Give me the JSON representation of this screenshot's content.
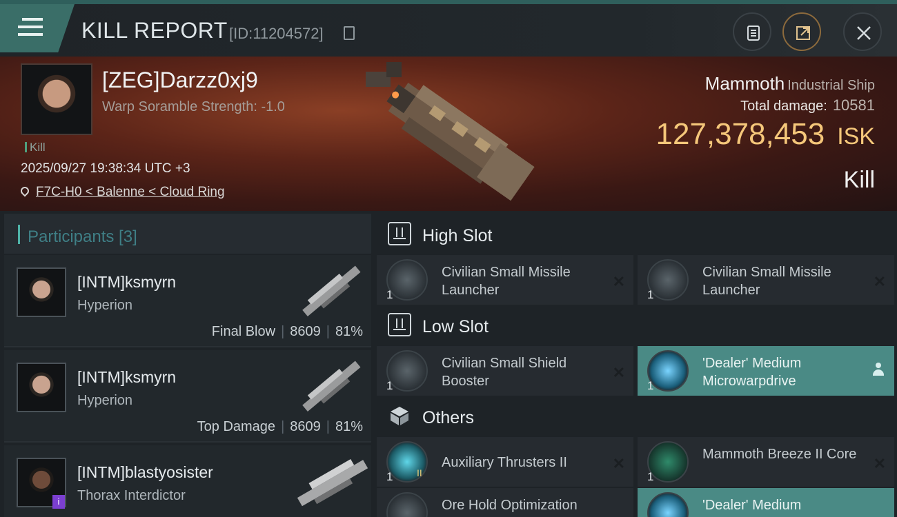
{
  "header": {
    "title": "KILL REPORT",
    "kill_id": "[ID:11204572]",
    "icons": [
      "menu-icon",
      "copy-icon",
      "clipboard-icon",
      "share-icon",
      "close-icon"
    ]
  },
  "victim": {
    "pilot_name": "[ZEG]Darzz0xj9",
    "scramble": "Warp Soramble Strength: -1.0",
    "kill_tag": "Kill",
    "datetime": "2025/09/27 19:38:34 UTC +3",
    "location": "F7C-H0 < Balenne < Cloud Ring",
    "ship_name": "Mammoth",
    "ship_class": "Industrial Ship",
    "total_damage_label": "Total damage:",
    "total_damage": "10581",
    "isk_value": "127,378,453",
    "isk_unit": "ISK",
    "result": "Kill"
  },
  "participants": {
    "label": "Participants [3]",
    "rows": [
      {
        "name": "[INTM]ksmyrn",
        "ship": "Hyperion",
        "role": "Final Blow",
        "damage": "8609",
        "percent": "81%"
      },
      {
        "name": "[INTM]ksmyrn",
        "ship": "Hyperion",
        "role": "Top Damage",
        "damage": "8609",
        "percent": "81%"
      },
      {
        "name": "[INTM]blastyosister",
        "ship": "Thorax Interdictor",
        "badge": "i"
      }
    ]
  },
  "fittings": {
    "high_slot": {
      "label": "High Slot",
      "items": [
        {
          "name": "Civilian Small Missile Launcher",
          "qty": "1"
        },
        {
          "name": "Civilian Small Missile Launcher",
          "qty": "1"
        }
      ]
    },
    "low_slot": {
      "label": "Low Slot",
      "items": [
        {
          "name": "Civilian Small Shield Booster",
          "qty": "1"
        },
        {
          "name": "'Dealer' Medium Microwarpdrive",
          "qty": "1"
        }
      ]
    },
    "others": {
      "label": "Others",
      "items": [
        {
          "name": "Auxiliary Thrusters II",
          "qty": "1",
          "tier": "II"
        },
        {
          "name": "Mammoth Breeze II Core",
          "qty": "1"
        },
        {
          "name": "Ore Hold Optimization"
        },
        {
          "name": "'Dealer' Medium"
        }
      ]
    }
  },
  "colors": {
    "accent": "#4fb3a8",
    "isk": "#f5c77a",
    "highlight": "#4a8a85"
  }
}
